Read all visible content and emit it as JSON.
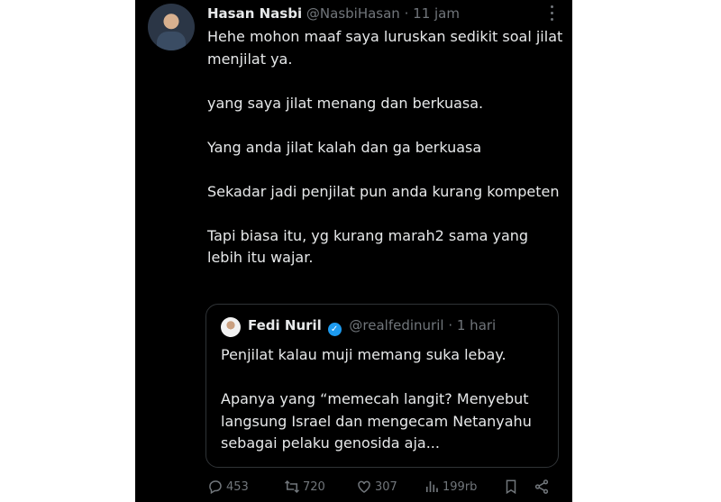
{
  "tweet": {
    "author_name": "Hasan Nasbi",
    "author_handle": "@NasbiHasan",
    "separator": "·",
    "time": "11 jam",
    "paragraphs": [
      "Hehe mohon maaf saya luruskan sedikit soal jilat menjilat ya.",
      "yang saya jilat menang dan berkuasa.",
      "Yang anda jilat kalah dan ga berkuasa",
      "Sekadar jadi penjilat pun anda kurang kompeten",
      "Tapi biasa itu, yg kurang marah2 sama yang lebih itu wajar."
    ]
  },
  "quote": {
    "author_name": "Fedi Nuril",
    "author_handle": "@realfedinuril",
    "separator": "·",
    "time": "1 hari",
    "paragraphs": [
      "Penjilat kalau muji memang suka lebay.",
      "Apanya yang “memecah langit? Menyebut langsung Israel dan mengecam Netanyahu sebagai pelaku genosida aja..."
    ]
  },
  "actions": {
    "replies": "453",
    "reposts": "720",
    "likes": "307",
    "views": "199rb"
  },
  "colors": {
    "background": "#000000",
    "text": "#e7e9ea",
    "muted": "#71767b",
    "border": "#2f3336",
    "verified": "#1d9bf0"
  }
}
